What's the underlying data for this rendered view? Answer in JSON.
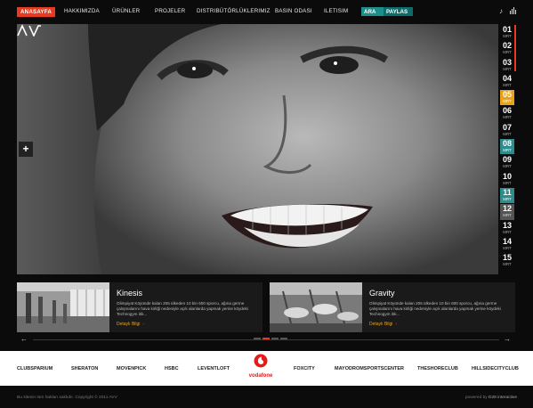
{
  "nav": {
    "items": [
      "ANASAYFA",
      "HAKKIMIZDA",
      "ÜRÜNLER",
      "PROJELER",
      "DISTRIBÜTÖRLÜKLERIMIZ",
      "BASIN ODASI",
      "ILETISIM"
    ],
    "search_label": "ARA",
    "share_label": "PAYLAS"
  },
  "hero": {
    "plus": "+"
  },
  "dates": [
    {
      "day": "01",
      "month": "MRT"
    },
    {
      "day": "02",
      "month": "MRT"
    },
    {
      "day": "03",
      "month": "MRT"
    },
    {
      "day": "04",
      "month": "MRT"
    },
    {
      "day": "05",
      "month": "MRT"
    },
    {
      "day": "06",
      "month": "MRT"
    },
    {
      "day": "07",
      "month": "MRT"
    },
    {
      "day": "08",
      "month": "MRT"
    },
    {
      "day": "09",
      "month": "MRT"
    },
    {
      "day": "10",
      "month": "MRT"
    },
    {
      "day": "11",
      "month": "MRT"
    },
    {
      "day": "12",
      "month": "MRT"
    },
    {
      "day": "13",
      "month": "MRT"
    },
    {
      "day": "14",
      "month": "MRT"
    },
    {
      "day": "15",
      "month": "MRT"
    }
  ],
  "cards": [
    {
      "title": "Kinesis",
      "desc": "Olimpiyat Köyünde kalan 205 ülkeden 10 bin 600 sporcu, ağına germe çalışmalarını hava kirliği nedeniyle açık alanlarda yapmak yerine köydeki Technogym itik...",
      "more": "Detaylı Bilgi"
    },
    {
      "title": "Gravity",
      "desc": "Olimpiyat Köyünde kalan 205 ülkeden 10 bin 600 sporcu, ağına germe çalışmalarını hava kirliği nedeniyle açık alanlarda yapmak yerine köydeki Technogym itik...",
      "more": "Detaylı Bilgi"
    }
  ],
  "brands": [
    "CLUBSPARIUM",
    "SHERATON",
    "MOVENPICK",
    "HSBC",
    "LEVENTLOFT",
    "vodafone",
    "FOXCITY",
    "MAYODROMSPORTSCENTER",
    "THESHORECLUB",
    "HILLSIDECITYCLUB"
  ],
  "footer": {
    "copyright": "Bu sitenin tüm hakları saklıdır. Copyright © 2011 AVV",
    "powered_prefix": "powered by ",
    "powered_name": "D28 interactive"
  },
  "colors": {
    "accent_red": "#e63b20",
    "accent_orange": "#e8a21b",
    "accent_teal": "#2f8c8c"
  }
}
